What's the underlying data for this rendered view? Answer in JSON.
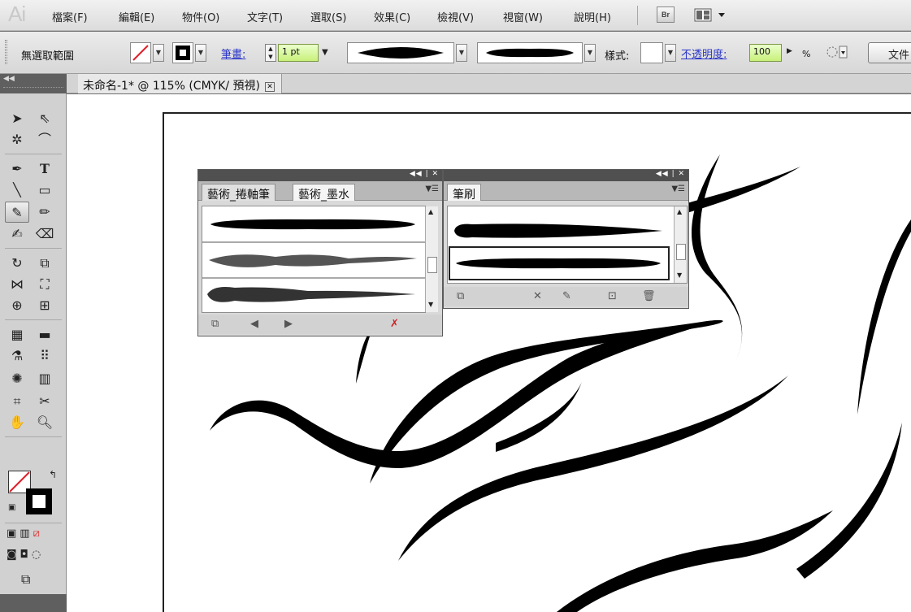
{
  "menu": {
    "logo": "Ai",
    "items": [
      "檔案(F)",
      "編輯(E)",
      "物件(O)",
      "文字(T)",
      "選取(S)",
      "效果(C)",
      "檢視(V)",
      "視窗(W)",
      "說明(H)"
    ],
    "bridge_label": "Br"
  },
  "control": {
    "selection_status": "無選取範圍",
    "stroke_label": "筆畫:",
    "stroke_weight": "1 pt",
    "style_label": "樣式:",
    "opacity_label": "不透明度:",
    "opacity_value": "100",
    "opacity_unit": "%",
    "doc_button": "文件"
  },
  "document": {
    "tab_title": "未命名-1* @ 115% (CMYK/ 預視)"
  },
  "panels": {
    "art_brushes": {
      "tabs": [
        "藝術_捲軸筆",
        "藝術_墨水"
      ]
    },
    "brushes": {
      "tab": "筆刷"
    }
  },
  "colors": {
    "menu_bg": "#e6e6e6",
    "panel_header": "#505050",
    "link_blue": "#2a35c8",
    "field_green": "#c8f07a"
  }
}
